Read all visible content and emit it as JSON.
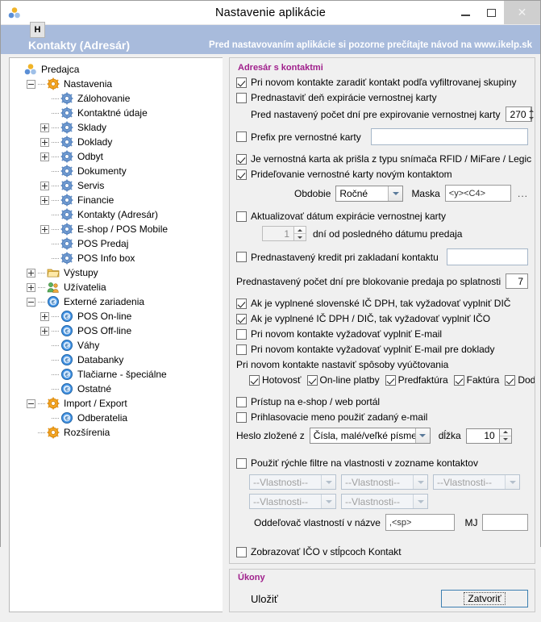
{
  "window": {
    "title": "Nastavenie aplikácie",
    "app_icon": "app-icon",
    "minimize_label": "–",
    "maximize_label": "□",
    "close_label": "✕"
  },
  "menu": {
    "items": [
      {
        "label": "H"
      }
    ]
  },
  "header": {
    "left_title": "Kontakty (Adresár)",
    "right_notice": "Pred nastavovaním aplikácie si pozorne prečítajte návod na www.ikelp.sk",
    "bg_color": "#a8bbdc",
    "text_color": "#ffffff"
  },
  "tree": {
    "nodes": [
      {
        "label": "Predajca",
        "depth": 0,
        "toggle": "none",
        "icon": "app-icon",
        "selected": false
      },
      {
        "label": "Nastavenia",
        "depth": 1,
        "toggle": "minus",
        "icon": "gear-orange",
        "selected": false
      },
      {
        "label": "Zálohovanie",
        "depth": 2,
        "toggle": "none",
        "icon": "gear-blue",
        "selected": false
      },
      {
        "label": "Kontaktné údaje",
        "depth": 2,
        "toggle": "none",
        "icon": "gear-blue",
        "selected": false
      },
      {
        "label": "Sklady",
        "depth": 2,
        "toggle": "plus",
        "icon": "gear-blue",
        "selected": false
      },
      {
        "label": "Doklady",
        "depth": 2,
        "toggle": "plus",
        "icon": "gear-blue",
        "selected": false
      },
      {
        "label": "Odbyt",
        "depth": 2,
        "toggle": "plus",
        "icon": "gear-blue",
        "selected": false
      },
      {
        "label": "Dokumenty",
        "depth": 2,
        "toggle": "none",
        "icon": "gear-blue",
        "selected": false
      },
      {
        "label": "Servis",
        "depth": 2,
        "toggle": "plus",
        "icon": "gear-blue",
        "selected": false
      },
      {
        "label": "Financie",
        "depth": 2,
        "toggle": "plus",
        "icon": "gear-blue",
        "selected": false
      },
      {
        "label": "Kontakty (Adresár)",
        "depth": 2,
        "toggle": "none",
        "icon": "gear-blue",
        "selected": true
      },
      {
        "label": "E-shop / POS Mobile",
        "depth": 2,
        "toggle": "plus",
        "icon": "gear-blue",
        "selected": false
      },
      {
        "label": "POS Predaj",
        "depth": 2,
        "toggle": "none",
        "icon": "gear-blue",
        "selected": false
      },
      {
        "label": "POS Info box",
        "depth": 2,
        "toggle": "none",
        "icon": "gear-blue",
        "selected": false
      },
      {
        "label": "Výstupy",
        "depth": 1,
        "toggle": "plus",
        "icon": "folder",
        "selected": false
      },
      {
        "label": "Užívatelia",
        "depth": 1,
        "toggle": "plus",
        "icon": "users",
        "selected": false
      },
      {
        "label": "Externé zariadenia",
        "depth": 1,
        "toggle": "minus",
        "icon": "euro-blue",
        "selected": false
      },
      {
        "label": "POS On-line",
        "depth": 2,
        "toggle": "plus",
        "icon": "euro-blue",
        "selected": false
      },
      {
        "label": "POS Off-line",
        "depth": 2,
        "toggle": "plus",
        "icon": "euro-blue",
        "selected": false
      },
      {
        "label": "Váhy",
        "depth": 2,
        "toggle": "none",
        "icon": "euro-blue",
        "selected": false
      },
      {
        "label": "Databanky",
        "depth": 2,
        "toggle": "none",
        "icon": "euro-blue",
        "selected": false
      },
      {
        "label": "Tlačiarne - špeciálne",
        "depth": 2,
        "toggle": "none",
        "icon": "euro-blue",
        "selected": false
      },
      {
        "label": "Ostatné",
        "depth": 2,
        "toggle": "none",
        "icon": "euro-blue",
        "selected": false
      },
      {
        "label": "Import / Export",
        "depth": 1,
        "toggle": "minus",
        "icon": "gear-orange",
        "selected": false
      },
      {
        "label": "Odberatelia",
        "depth": 2,
        "toggle": "none",
        "icon": "euro-blue",
        "selected": false
      },
      {
        "label": "Rozšírenia",
        "depth": 1,
        "toggle": "none",
        "icon": "gear-orange",
        "selected": false
      }
    ]
  },
  "settings": {
    "group_title": "Adresár s kontaktmi",
    "group_title_color": "#a0208c",
    "cb_group_by_filter": {
      "label": "Pri novom kontakte zaradiť kontakt podľa vyfiltrovanej skupiny",
      "checked": true
    },
    "cb_preset_expiry_day": {
      "label": "Prednastaviť deň expirácie vernostnej karty",
      "checked": false
    },
    "preset_days_label": "Pred nastavený počet dní pre expirovanie vernostnej karty",
    "preset_days_value": "270",
    "cb_prefix_loyalty": {
      "label": "Prefix pre vernostné karty",
      "checked": false
    },
    "prefix_value": "",
    "cb_loyalty_from_reader": {
      "label": "Je vernostná karta ak prišla z typu snímača  RFID / MiFare / Legic",
      "checked": true
    },
    "cb_assign_loyalty_new": {
      "label": "Prideľovanie vernostné karty novým kontaktom",
      "checked": true
    },
    "period_label": "Obdobie",
    "period_value": "Ročné",
    "period_options": [
      "Ročné"
    ],
    "mask_label": "Maska",
    "mask_value": "<y><C4>",
    "mask_browse": "...",
    "cb_update_expiry": {
      "label": "Aktualizovať dátum expirácie vernostnej karty",
      "checked": false
    },
    "days_since_sale_value": "1",
    "days_since_sale_label": "dní od posledného dátumu predaja",
    "cb_preset_credit": {
      "label": "Prednastavený kredit pri zakladaní kontaktu",
      "checked": false
    },
    "preset_credit_value": "",
    "block_sale_days_label": "Prednastavený počet dní pre blokovanie predaja po splatnosti",
    "block_sale_days_value": "7",
    "cb_require_dic": {
      "label": "Ak je vyplnené slovenské IČ DPH, tak vyžadovať vyplniť DIČ",
      "checked": true
    },
    "cb_require_ico": {
      "label": "Ak je vyplnené IČ DPH / DIČ, tak vyžadovať vyplniť IČO",
      "checked": true
    },
    "cb_require_email": {
      "label": "Pri novom kontakte vyžadovať vyplniť E-mail",
      "checked": false
    },
    "cb_require_email_docs": {
      "label": "Pri novom kontakte vyžadovať vyplniť E-mail pre doklady",
      "checked": false
    },
    "payment_modes_label": "Pri novom kontakte nastaviť spôsoby vyúčtovania",
    "payment_modes": [
      {
        "label": "Hotovosť",
        "checked": true
      },
      {
        "label": "On-line platby",
        "checked": true
      },
      {
        "label": "Predfaktúra",
        "checked": true
      },
      {
        "label": "Faktúra",
        "checked": true
      },
      {
        "label": "Dodací lis",
        "checked": true
      }
    ],
    "cb_eshop_access": {
      "label": "Prístup na e-shop / web portál",
      "checked": false
    },
    "cb_login_email": {
      "label": "Prihlasovacie meno použiť zadaný e-mail",
      "checked": false
    },
    "password_label": "Heslo zložené z",
    "password_value": "Čísla, malé/veľké písmená, od",
    "password_options": [
      "Čísla, malé/veľké písmená, od"
    ],
    "length_label": "dĺžka",
    "length_value": "10",
    "cb_quick_filters": {
      "label": "Použiť rýchle filtre na vlastnosti v zozname kontaktov",
      "checked": false
    },
    "property_selects": [
      {
        "value": "--Vlastnosti--"
      },
      {
        "value": "--Vlastnosti--"
      },
      {
        "value": "--Vlastnosti--"
      },
      {
        "value": "--Vlastnosti--"
      },
      {
        "value": "--Vlastnosti--"
      }
    ],
    "separator_label": "Oddeľovač vlastností v názve",
    "separator_value": ",<sp>",
    "mj_label": "MJ",
    "mj_value": "",
    "cb_show_ico_column": {
      "label": "Zobrazovať IČO v stĺpcoch Kontakt",
      "checked": false
    }
  },
  "actions": {
    "group_title": "Úkony",
    "save_label": "Uložiť",
    "close_label": "Zatvoriť"
  }
}
